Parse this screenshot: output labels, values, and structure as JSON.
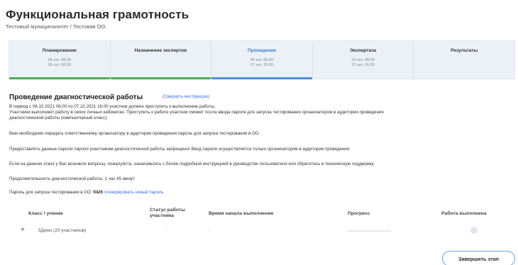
{
  "header": {
    "title": "Функциональная грамотность",
    "subtitle": "Тестовый муниципалитет / Тестовая ОО."
  },
  "stages": [
    {
      "name": "Планирование",
      "date_start": "04 окт. 08:00",
      "date_end": "06 окт. 08:00",
      "state": "done"
    },
    {
      "name": "Назначение экспертов",
      "date_start": "",
      "date_end": "",
      "state": "done"
    },
    {
      "name": "Проведение",
      "date_start": "06 окт. 00:00",
      "date_end": "07 окт. 16:00",
      "state": "active"
    },
    {
      "name": "Экспертиза",
      "date_start": "15 окт. 08:00",
      "date_end": "31 окт. 16:00",
      "state": "pending"
    },
    {
      "name": "Результаты",
      "date_start": "",
      "date_end": "",
      "state": "pending"
    }
  ],
  "instructions": {
    "title": "Проведение диагностической работы",
    "collapse_link": "(Свернуть инструкцию)",
    "p1": "В период с 06.10.2021 06:00 по 07.10.2021 16:00 участник должен приступить к выполнению работы.",
    "p2": "Участники выполняют работу в своих личных кабинетах. Приступить к работе участник сможет после ввода пароля для запуска тестирования организатором в аудитории проведения",
    "p3": "диагностической работы (компьютерный класс).",
    "p4": "Вам необходимо передать ответственному организатору в аудитории проведения пароль для запуска тестирования в ОО.",
    "p5": "Предоставлять данные пароли пароли участникам диагностической работы запрещено! Ввод пароля осуществляется только организатором в аудитории проведения.",
    "p6": "Если на данном этапе у Вас возникли вопросы, пожалуйста, ознакомьтесь с более подробной инструкцией в руководстве пользователя или обратитесь в техническую поддержку.",
    "duration_label": "Продолжительность диагностической работы: ",
    "duration_value": "1 час 45 минут",
    "password_label": "Пароль для запуска тестирования в ОО: ",
    "password_value": "9426",
    "generate_link": "сгенерировать новый пароль"
  },
  "table": {
    "headers": {
      "class": "Класс / ученик",
      "status": "Статус работы участника",
      "start": "Время начала выполнение",
      "progress": "Прогресс",
      "done": "Работа выполнена"
    },
    "rows": [
      {
        "class": "5Демо (20 участников)",
        "status": "-",
        "start": "-",
        "progress": 0,
        "done": false
      }
    ]
  },
  "finish_button": "Завершить этап",
  "colors": {
    "done": "#4caf50",
    "active": "#4a8fd6",
    "link": "#3b6fd6"
  }
}
